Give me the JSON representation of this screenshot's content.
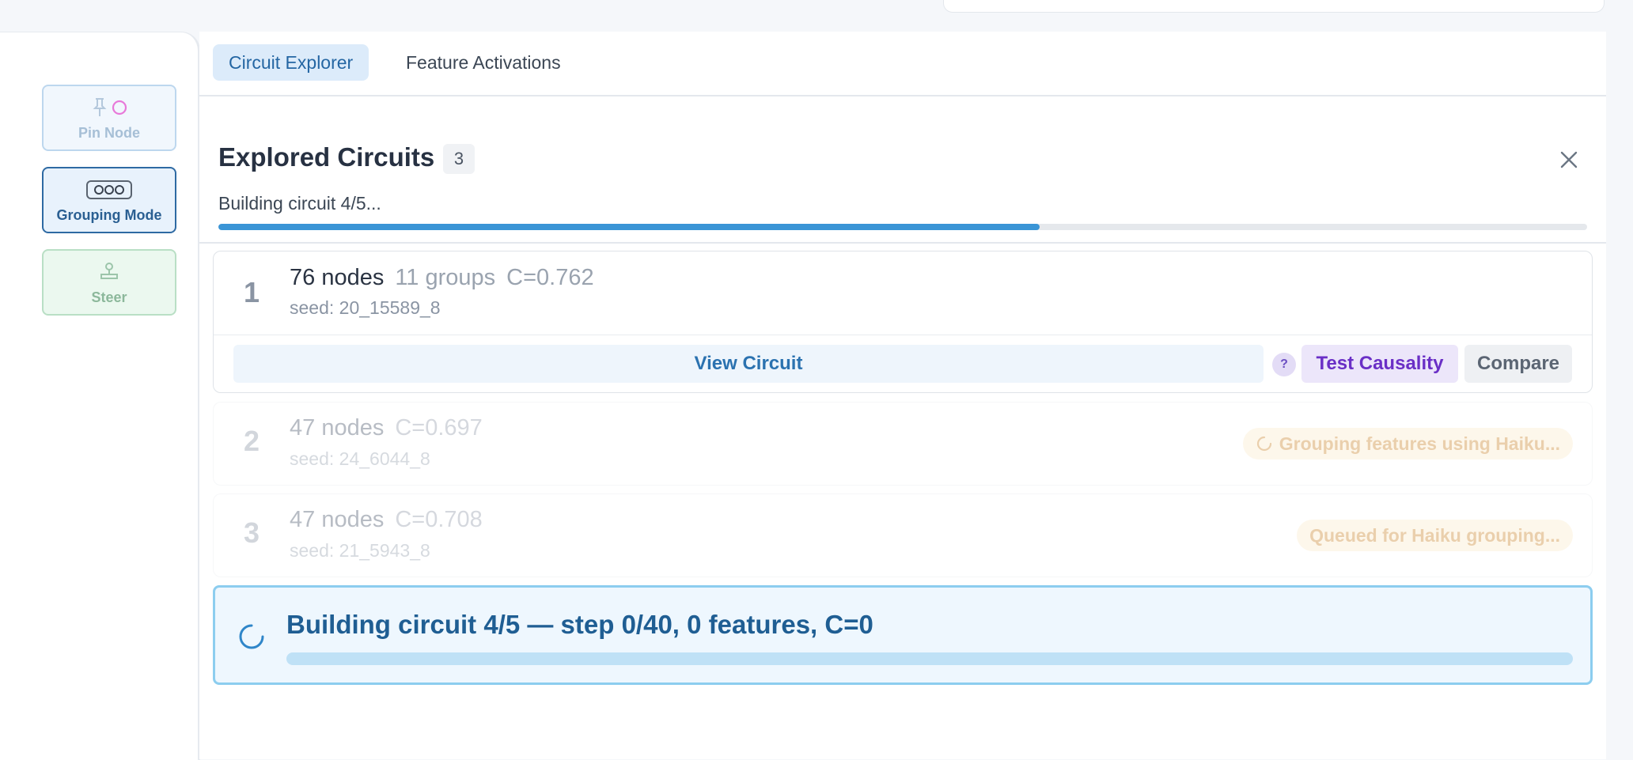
{
  "toolbar": {
    "pin_node": "Pin Node",
    "grouping_mode": "Grouping Mode",
    "steer": "Steer"
  },
  "tabs": {
    "circuit_explorer": "Circuit Explorer",
    "feature_activations": "Feature Activations"
  },
  "panel": {
    "title": "Explored Circuits",
    "count": "3",
    "status": "Building circuit 4/5...",
    "progress_fraction": 0.6
  },
  "circuits": [
    {
      "index": "1",
      "nodes": "76 nodes",
      "groups": "11 groups",
      "score": "C=0.762",
      "seed": "seed: 20_15589_8",
      "actions": {
        "view": "View Circuit",
        "help": "?",
        "test": "Test Causality",
        "compare": "Compare"
      }
    },
    {
      "index": "2",
      "nodes": "47 nodes",
      "score": "C=0.697",
      "seed": "seed: 24_6044_8",
      "status": "Grouping features using Haiku..."
    },
    {
      "index": "3",
      "nodes": "47 nodes",
      "score": "C=0.708",
      "seed": "seed: 21_5943_8",
      "status": "Queued for Haiku grouping..."
    }
  ],
  "building": {
    "text": "Building circuit 4/5 — step 0/40, 0 features, C=0",
    "progress_fraction": 0
  },
  "colors": {
    "accent": "#3a95d6",
    "causality": "#6a2fc6",
    "pending": "#d9a86a"
  },
  "icons": [
    "pin-icon",
    "circle-icon",
    "grouping-icon",
    "steer-icon",
    "close-icon",
    "spinner-icon"
  ]
}
